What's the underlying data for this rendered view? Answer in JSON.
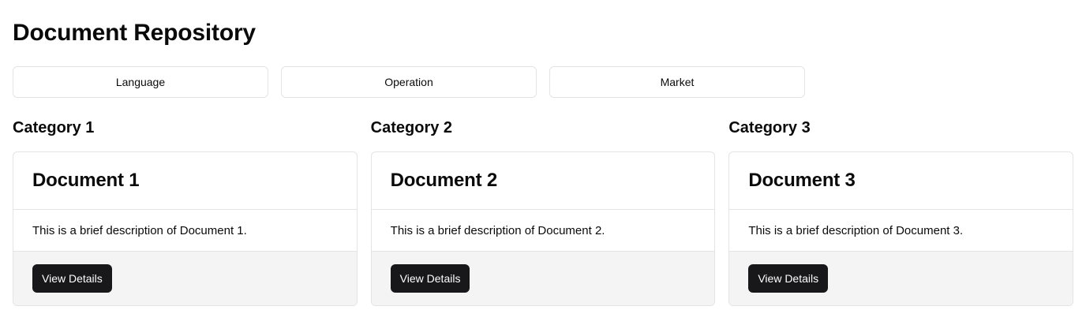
{
  "header": {
    "title": "Document Repository"
  },
  "filters": [
    {
      "label": "Language"
    },
    {
      "label": "Operation"
    },
    {
      "label": "Market"
    }
  ],
  "categories": [
    {
      "title": "Category 1",
      "document": {
        "title": "Document 1",
        "description": "This is a brief description of Document 1.",
        "button_label": "View Details"
      }
    },
    {
      "title": "Category 2",
      "document": {
        "title": "Document 2",
        "description": "This is a brief description of Document 2.",
        "button_label": "View Details"
      }
    },
    {
      "title": "Category 3",
      "document": {
        "title": "Document 3",
        "description": "This is a brief description of Document 3.",
        "button_label": "View Details"
      }
    }
  ],
  "colors": {
    "primary_button": "#18181b",
    "border": "#e4e4e7",
    "footer_bg": "#f4f4f5"
  }
}
